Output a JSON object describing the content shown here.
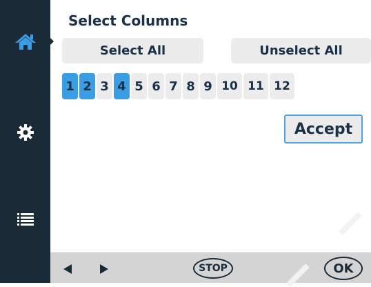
{
  "sidebar": {
    "items": [
      {
        "icon": "home-icon",
        "active": true
      },
      {
        "icon": "gear-icon"
      },
      {
        "icon": "list-icon"
      }
    ]
  },
  "main": {
    "title": "Select Columns",
    "select_all_label": "Select All",
    "unselect_all_label": "Unselect All",
    "columns": [
      {
        "label": "1",
        "selected": true
      },
      {
        "label": "2",
        "selected": true
      },
      {
        "label": "3",
        "selected": false
      },
      {
        "label": "4",
        "selected": true
      },
      {
        "label": "5",
        "selected": false
      },
      {
        "label": "6",
        "selected": false
      },
      {
        "label": "7",
        "selected": false
      },
      {
        "label": "8",
        "selected": false
      },
      {
        "label": "9",
        "selected": false
      },
      {
        "label": "10",
        "selected": false
      },
      {
        "label": "11",
        "selected": false
      },
      {
        "label": "12",
        "selected": false
      }
    ],
    "accept_label": "Accept"
  },
  "bottombar": {
    "back_icon": "arrow-left-icon",
    "forward_icon": "arrow-right-icon",
    "stop_label": "STOP",
    "ok_label": "OK"
  },
  "colors": {
    "sidebar": "#1b2a37",
    "accent": "#3a9ee4",
    "button": "#ececec",
    "text": "#1b3147",
    "bottombar": "#d4d4d4"
  }
}
